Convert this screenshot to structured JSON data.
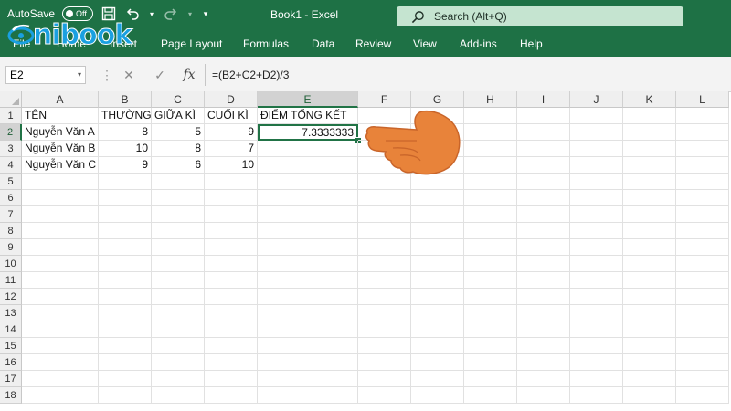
{
  "titlebar": {
    "autosave_label": "AutoSave",
    "autosave_state": "Off",
    "document_title": "Book1 - Excel",
    "search_placeholder": "Search (Alt+Q)",
    "accent": "#1e7145"
  },
  "logo": {
    "text": "nibook"
  },
  "ribbon": {
    "tabs": [
      "File",
      "Home",
      "Insert",
      "Page Layout",
      "Formulas",
      "Data",
      "Review",
      "View",
      "Add-ins",
      "Help"
    ]
  },
  "formula_bar": {
    "name_box": "E2",
    "formula": "=(B2+C2+D2)/3"
  },
  "sheet": {
    "columns": [
      "A",
      "B",
      "C",
      "D",
      "E",
      "F",
      "G",
      "H",
      "I",
      "J",
      "K",
      "L"
    ],
    "rows": [
      "1",
      "2",
      "3",
      "4",
      "5",
      "6",
      "7",
      "8",
      "9",
      "10",
      "11",
      "12",
      "13",
      "14",
      "15",
      "16",
      "17",
      "18"
    ],
    "cells": {
      "A1": "TÊN",
      "B1": "THƯỜNG XUYÊN",
      "C1": "GIỮA KÌ",
      "D1": "CUỐI KÌ",
      "E1": "ĐIỂM TỔNG KẾT",
      "A2": "Nguyễn Văn A",
      "B2": "8",
      "C2": "5",
      "D2": "9",
      "E2": "7.3333333",
      "A3": "Nguyễn Văn B",
      "B3": "10",
      "C3": "8",
      "D3": "7",
      "A4": "Nguyễn Văn C",
      "B4": "9",
      "C4": "6",
      "D4": "10"
    },
    "active_cell": "E2",
    "selection_color": "#217346"
  }
}
